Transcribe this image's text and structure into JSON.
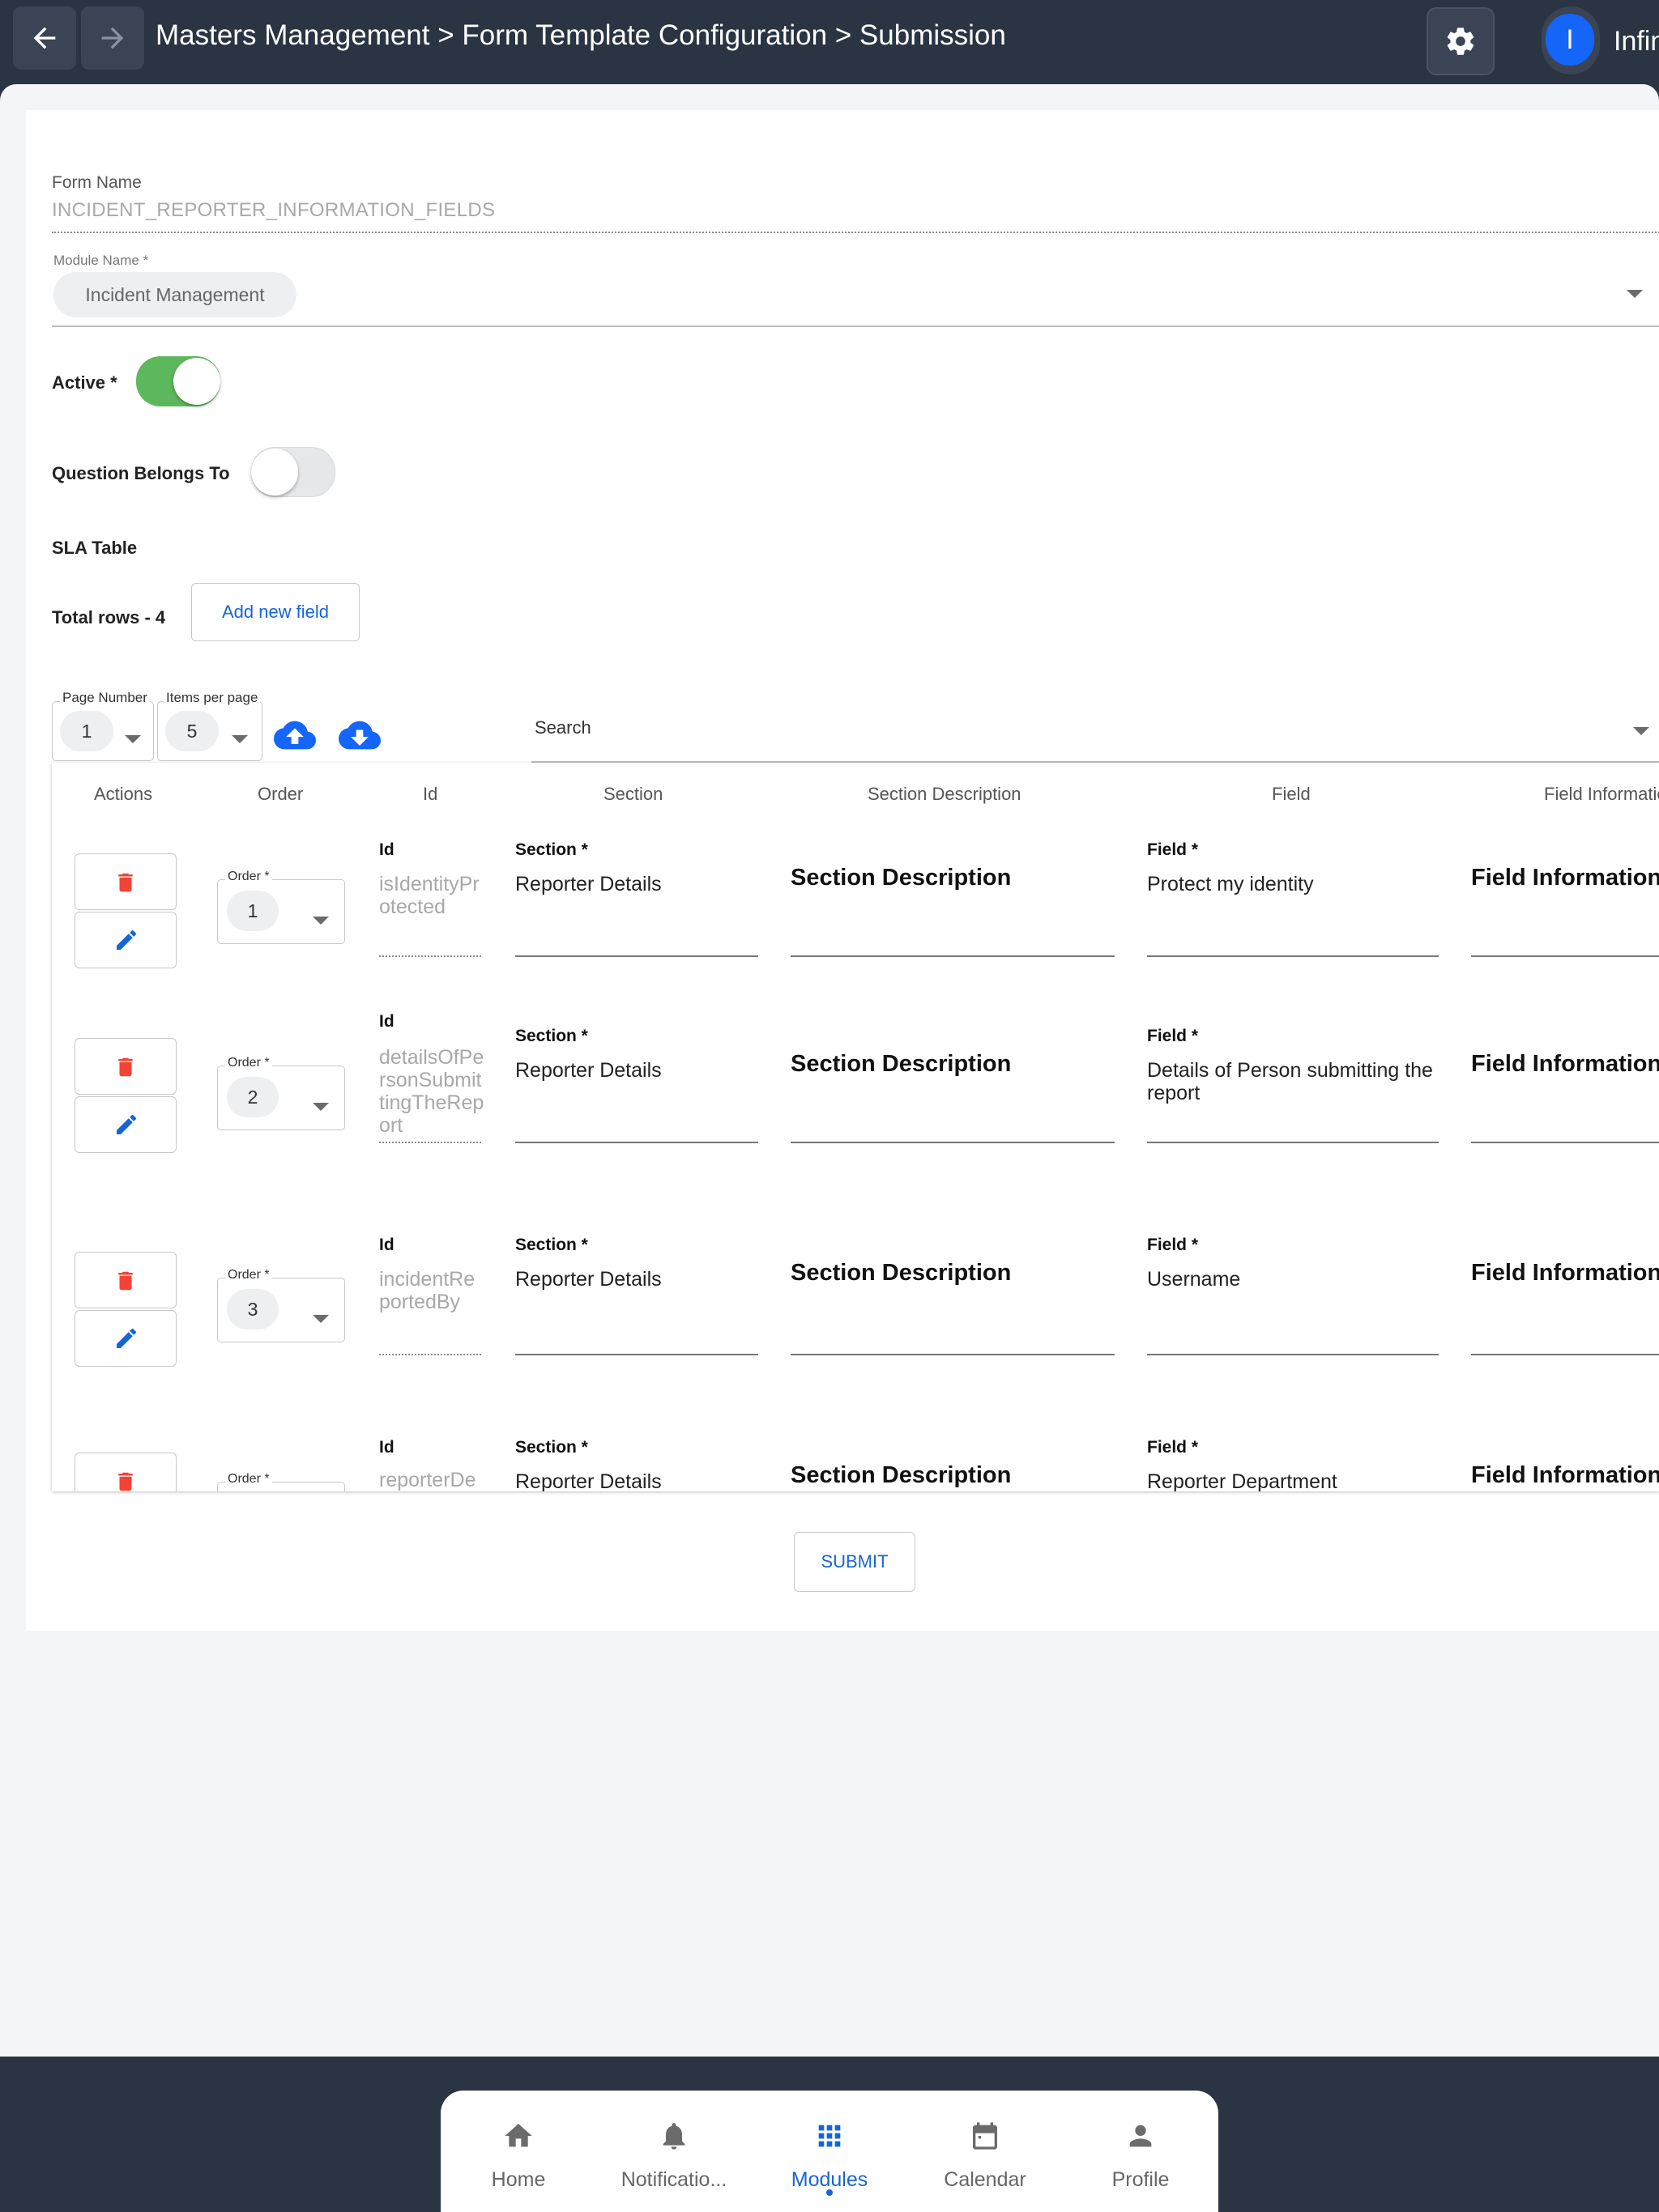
{
  "header": {
    "breadcrumb": "Masters Management > Form Template Configuration > Submission",
    "avatar_initial": "I",
    "user_name": "Infinity"
  },
  "form": {
    "form_name_label": "Form Name",
    "form_name_value": "INCIDENT_REPORTER_INFORMATION_FIELDS",
    "module_name_label": "Module Name *",
    "module_name_value": "Incident Management",
    "active_label": "Active *",
    "active_on": true,
    "question_belongs_label": "Question Belongs To",
    "question_belongs_on": false,
    "sla_table_label": "SLA Table",
    "total_rows_label": "Total rows - 4",
    "add_field_label": "Add new field"
  },
  "pager": {
    "page_number_label": "Page Number",
    "page_number_value": "1",
    "items_per_page_label": "Items per page",
    "items_per_page_value": "5",
    "search_placeholder": "Search"
  },
  "table": {
    "headers": [
      "Actions",
      "Order",
      "Id",
      "Section",
      "Section Description",
      "Field",
      "Field Information"
    ],
    "order_label": "Order *",
    "id_label": "Id",
    "section_label": "Section *",
    "section_desc_title": "Section Description",
    "field_label": "Field *",
    "field_info_title": "Field Information",
    "rows": [
      {
        "order": "1",
        "id": "isIdentityProtected",
        "section": "Reporter Details",
        "field": "Protect my identity"
      },
      {
        "order": "2",
        "id": "detailsOfPersonSubmittingTheReport",
        "section": "Reporter Details",
        "field": "Details of Person submitting the report"
      },
      {
        "order": "3",
        "id": "incidentReportedBy",
        "section": "Reporter Details",
        "field": "Username"
      },
      {
        "order": "",
        "id": "reporterDe",
        "section": "Reporter Details",
        "field": "Reporter Department"
      }
    ]
  },
  "submit_label": "SUBMIT",
  "bottom_nav": {
    "items": [
      {
        "label": "Home",
        "icon": "home-icon"
      },
      {
        "label": "Notificatio...",
        "icon": "bell-icon"
      },
      {
        "label": "Modules",
        "icon": "grid-icon",
        "active": true
      },
      {
        "label": "Calendar",
        "icon": "calendar-icon"
      },
      {
        "label": "Profile",
        "icon": "person-icon"
      }
    ]
  },
  "colors": {
    "header_bg": "#2a3443",
    "accent": "#1565d8",
    "toggle_on": "#5cb85c",
    "delete_red": "#f44336"
  }
}
